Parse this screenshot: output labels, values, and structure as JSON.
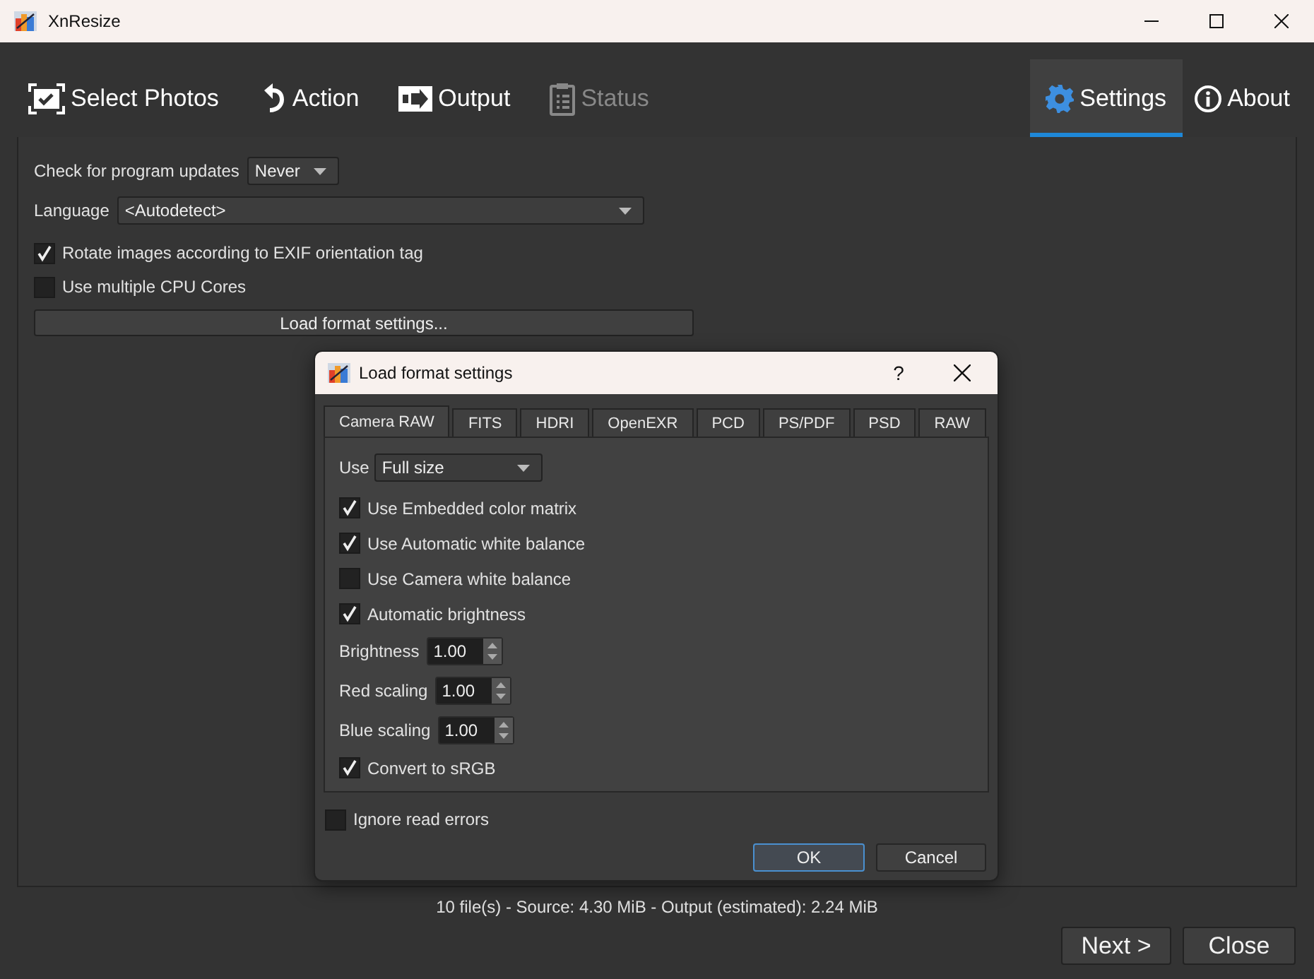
{
  "window": {
    "title": "XnResize"
  },
  "nav_tabs": {
    "left": [
      {
        "label": "Select Photos",
        "kind": "select",
        "selected": false,
        "disabled": false
      },
      {
        "label": "Action",
        "kind": "action",
        "selected": false,
        "disabled": false
      },
      {
        "label": "Output",
        "kind": "output",
        "selected": false,
        "disabled": false
      },
      {
        "label": "Status",
        "kind": "status",
        "selected": false,
        "disabled": true
      }
    ],
    "right": [
      {
        "label": "Settings",
        "kind": "settings",
        "selected": true,
        "disabled": false
      },
      {
        "label": "About",
        "kind": "about",
        "selected": false,
        "disabled": false
      }
    ]
  },
  "settings": {
    "update_check": {
      "label": "Check for program updates",
      "value": "Never"
    },
    "language": {
      "label": "Language",
      "value": "<Autodetect>"
    },
    "checkboxes": [
      {
        "label": "Rotate images according to EXIF orientation tag",
        "checked": true
      },
      {
        "label": "Use multiple CPU Cores",
        "checked": false
      }
    ],
    "load_button": "Load format settings..."
  },
  "dialog": {
    "title": "Load format settings",
    "help": "?",
    "tabs": [
      {
        "label": "Camera RAW",
        "selected": true
      },
      {
        "label": "FITS",
        "selected": false
      },
      {
        "label": "HDRI",
        "selected": false
      },
      {
        "label": "OpenEXR",
        "selected": false
      },
      {
        "label": "PCD",
        "selected": false
      },
      {
        "label": "PS/PDF",
        "selected": false
      },
      {
        "label": "PSD",
        "selected": false
      },
      {
        "label": "RAW",
        "selected": false
      }
    ],
    "options": [
      {
        "kind": "combo",
        "label": "Use",
        "value": "Full size"
      },
      {
        "kind": "checkbox",
        "label": "Use Embedded color matrix",
        "checked": true
      },
      {
        "kind": "checkbox",
        "label": "Use Automatic white balance",
        "checked": true
      },
      {
        "kind": "checkbox",
        "label": "Use Camera white balance",
        "checked": false
      },
      {
        "kind": "checkbox",
        "label": "Automatic brightness",
        "checked": true
      },
      {
        "kind": "spin",
        "label": "Brightness",
        "value": "1.00"
      },
      {
        "kind": "spin",
        "label": "Red scaling",
        "value": "1.00"
      },
      {
        "kind": "spin",
        "label": "Blue scaling",
        "value": "1.00"
      },
      {
        "kind": "checkbox",
        "label": "Convert to sRGB",
        "checked": true
      }
    ],
    "ignore_errors": {
      "label": "Ignore read errors",
      "checked": false
    },
    "buttons": [
      {
        "label": "OK",
        "default": true
      },
      {
        "label": "Cancel",
        "default": false
      }
    ]
  },
  "status_text": "10 file(s) - Source: 4.30 MiB - Output (estimated): 2.24 MiB",
  "footer_buttons": [
    "Next >",
    "Close"
  ]
}
